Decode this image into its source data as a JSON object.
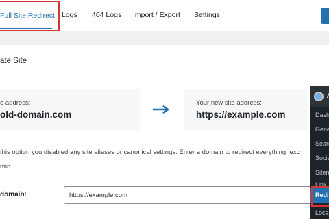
{
  "tabs": {
    "active": "Full Site Redirect",
    "items": [
      "Logs",
      "404 Logs",
      "Import / Export",
      "Settings"
    ]
  },
  "section": {
    "title": "ate Site"
  },
  "cards": {
    "old": {
      "label": "e address:",
      "value": "old-domain.com"
    },
    "new": {
      "label": "Your new site address:",
      "value": "https://example.com"
    }
  },
  "description": "this option you disabled any site aliases or canonical settings. Enter a domain to redirect everything, exc min.",
  "form": {
    "label": "domain:",
    "value": "https://example.com"
  },
  "wp_menu": {
    "head": "A",
    "items": [
      "Dash",
      "Gene",
      "Searc",
      "Socia",
      "Siten",
      "Link",
      "Redi",
      "Loca"
    ]
  },
  "colors": {
    "accent": "#2271b1",
    "highlight": "#d63638",
    "sidebar": "#1d2327"
  },
  "icons": [
    "arrow-right-icon",
    "wordpress-logo-icon"
  ]
}
